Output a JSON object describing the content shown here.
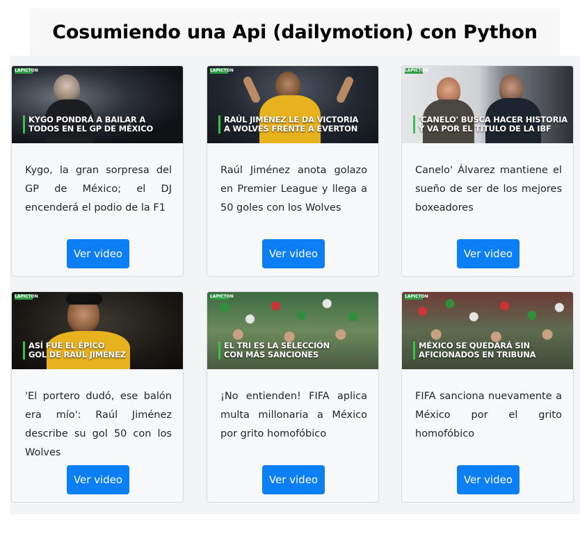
{
  "header": {
    "title": "Cosumiendo una Api (dailymotion) con Python"
  },
  "cards": [
    {
      "thumb_text": [
        "KYGO PONDRÁ A BAILAR A",
        "TODOS EN EL GP DE MÉXICO"
      ],
      "description": "Kygo, la gran sorpresa del GP de México; el DJ encenderá el podio de la F1",
      "button_label": "Ver video",
      "brand": "LAPICTON"
    },
    {
      "thumb_text": [
        "RAÚL JIMÉNEZ LE DA VICTORIA",
        "A WOLVES FRENTE A EVERTON"
      ],
      "description": "Raúl Jiménez anota golazo en Premier League y llega a 50 goles con los Wolves",
      "button_label": "Ver video",
      "brand": "LAPICTON"
    },
    {
      "thumb_text": [
        "'CANELO' BUSCA HACER HISTORIA",
        "Y VA POR EL TÍTULO DE LA IBF"
      ],
      "description": "Canelo' Álvarez mantiene el sueño de ser de los mejores boxeadores",
      "button_label": "Ver video",
      "brand": "LAPICTON"
    },
    {
      "thumb_text": [
        "ASÍ FUE EL ÉPICO",
        "GOL DE RAÚL JIMÉNEZ"
      ],
      "description": "'El portero dudó, ese balón era mío': Raúl Jiménez describe su gol 50 con los Wolves",
      "button_label": "Ver video",
      "brand": "LAPICTON"
    },
    {
      "thumb_text": [
        "EL TRI ES LA SELECCIÓN",
        "CON MÁS SANCIONES"
      ],
      "description": "¡No entienden! FIFA aplica multa millonaria a México por grito homofóbico",
      "button_label": "Ver video",
      "brand": "LAPICTON"
    },
    {
      "thumb_text": [
        "MÉXICO SE QUEDARÁ SIN",
        "AFICIONADOS EN TRIBUNA"
      ],
      "description": "FIFA sanciona nuevamente a México por el grito homofóbico",
      "button_label": "Ver video",
      "brand": "LAPICTON"
    }
  ],
  "colors": {
    "button": "#0d7ff5",
    "accent_green": "#3ec14a"
  }
}
